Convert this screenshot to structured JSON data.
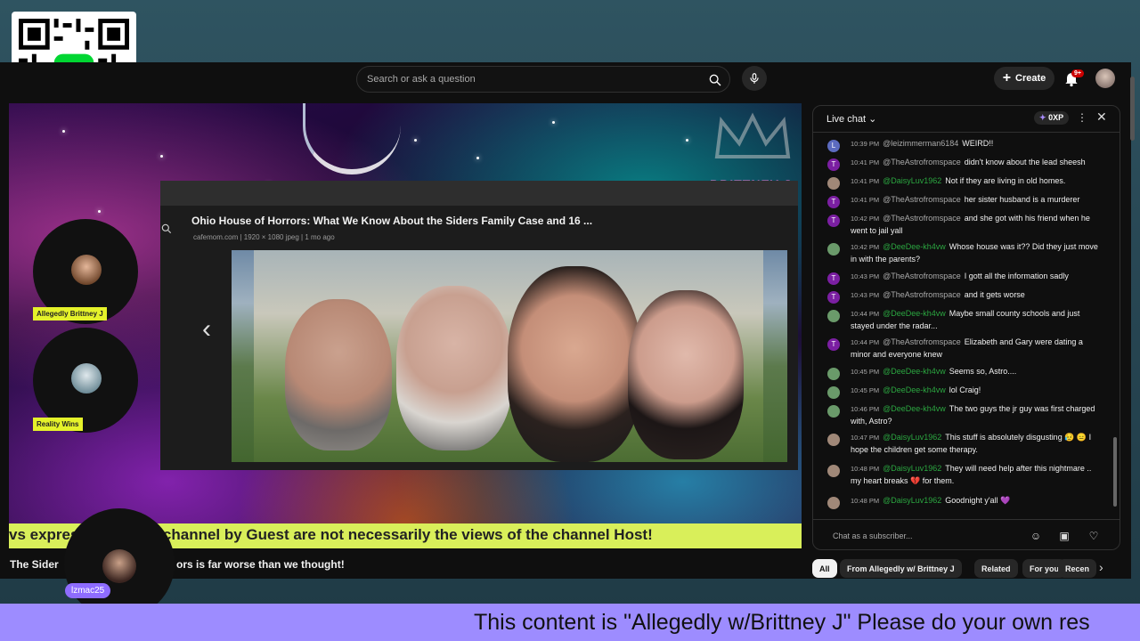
{
  "topbar": {
    "search_placeholder": "Search or ask a question",
    "create_label": "Create",
    "notifications_badge": "9+"
  },
  "video": {
    "brand_tag": "BRITTNEY J",
    "panel": {
      "title": "Ohio House of Horrors: What We Know About the Siders Family Case and 16 ...",
      "meta": "cafemom.com  |  1920 × 1080 jpeg  |  1 mo ago"
    },
    "guests": [
      {
        "label": "Allegedly Brittney J"
      },
      {
        "label": "Reality Wins"
      }
    ],
    "ticker": "vs expressed on this channel by Guest are not necessarily the views of the channel Host!",
    "host_label": "lzmac25",
    "title_left": "The Sider",
    "title_right": "ors is far worse than we thought!"
  },
  "chat": {
    "title": "Live chat",
    "xp": "0XP",
    "input_placeholder": "Chat as a subscriber...",
    "messages": [
      {
        "avatar": "L",
        "color": "#5c6bc0",
        "time": "10:39 PM",
        "author": "@leizimmerman6184",
        "member": false,
        "text": "WEIRD!!"
      },
      {
        "avatar": "T",
        "color": "#7b1fa2",
        "time": "10:41 PM",
        "author": "@TheAstrofromspace",
        "member": false,
        "text": "didn't know about the lead sheesh"
      },
      {
        "avatar": "",
        "color": "#a08878",
        "time": "10:41 PM",
        "author": "@DaisyLuv1962",
        "member": true,
        "text": "Not if they are living in old homes."
      },
      {
        "avatar": "T",
        "color": "#7b1fa2",
        "time": "10:41 PM",
        "author": "@TheAstrofromspace",
        "member": false,
        "text": "her sister husband is a murderer"
      },
      {
        "avatar": "T",
        "color": "#7b1fa2",
        "time": "10:42 PM",
        "author": "@TheAstrofromspace",
        "member": false,
        "text": "and she got with his friend when he went to jail yall"
      },
      {
        "avatar": "",
        "color": "#6a9a6a",
        "time": "10:42 PM",
        "author": "@DeeDee-kh4vw",
        "member": true,
        "text": "Whose house was it?? Did they just move in with the parents?"
      },
      {
        "avatar": "T",
        "color": "#7b1fa2",
        "time": "10:43 PM",
        "author": "@TheAstrofromspace",
        "member": false,
        "text": "I gott all the information sadly"
      },
      {
        "avatar": "T",
        "color": "#7b1fa2",
        "time": "10:43 PM",
        "author": "@TheAstrofromspace",
        "member": false,
        "text": "and it gets worse"
      },
      {
        "avatar": "",
        "color": "#6a9a6a",
        "time": "10:44 PM",
        "author": "@DeeDee-kh4vw",
        "member": true,
        "text": "Maybe small county schools and just stayed under the radar..."
      },
      {
        "avatar": "T",
        "color": "#7b1fa2",
        "time": "10:44 PM",
        "author": "@TheAstrofromspace",
        "member": false,
        "text": "Elizabeth and Gary were dating a minor and everyone knew"
      },
      {
        "avatar": "",
        "color": "#6a9a6a",
        "time": "10:45 PM",
        "author": "@DeeDee-kh4vw",
        "member": true,
        "text": "Seems so, Astro...."
      },
      {
        "avatar": "",
        "color": "#6a9a6a",
        "time": "10:45 PM",
        "author": "@DeeDee-kh4vw",
        "member": true,
        "text": "lol Craig!"
      },
      {
        "avatar": "",
        "color": "#6a9a6a",
        "time": "10:46 PM",
        "author": "@DeeDee-kh4vw",
        "member": true,
        "text": "The two guys the jr guy was first charged with, Astro?"
      },
      {
        "avatar": "",
        "color": "#a08878",
        "time": "10:47 PM",
        "author": "@DaisyLuv1962",
        "member": true,
        "text": "This stuff is absolutely disgusting 😥 😑 I hope the children get some therapy."
      },
      {
        "avatar": "",
        "color": "#a08878",
        "time": "10:48 PM",
        "author": "@DaisyLuv1962",
        "member": true,
        "text": "They will need help after this nightmare .. my heart breaks 💔 for them."
      },
      {
        "avatar": "",
        "color": "#a08878",
        "time": "10:48 PM",
        "author": "@DaisyLuv1962",
        "member": true,
        "text": "Goodnight y'all 💜"
      }
    ]
  },
  "chips": [
    "All",
    "From Allegedly w/ Brittney J",
    "Related",
    "For you",
    "Recen"
  ],
  "banner": "This content is \"Allegedly w/Brittney J\" Please do your own res"
}
